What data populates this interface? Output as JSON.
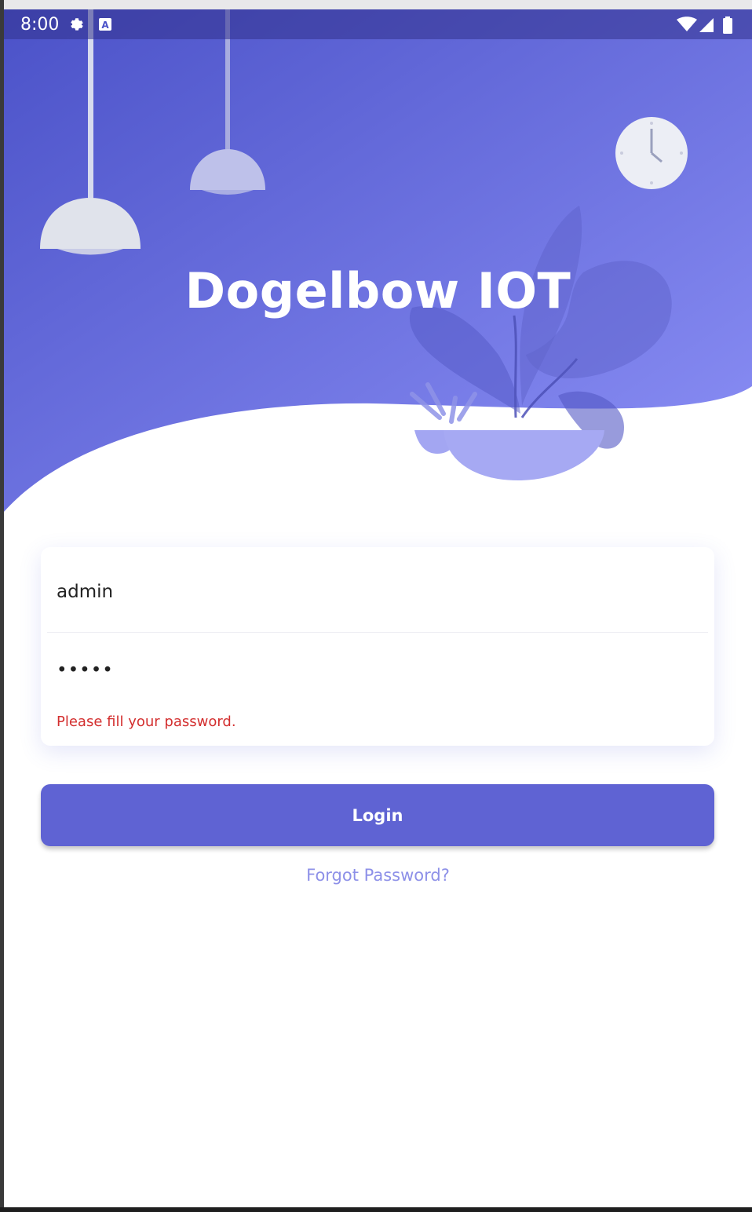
{
  "status_bar": {
    "time": "8:00",
    "icons": [
      "settings-icon",
      "keyboard-a-icon",
      "wifi-icon",
      "signal-icon",
      "battery-icon"
    ]
  },
  "header": {
    "title": "Dogelbow IOT",
    "gradient_start": "#4b52c8",
    "gradient_end": "#8a8ef5"
  },
  "login_form": {
    "username_value": "admin",
    "password_masked": "•••••",
    "password_error": "Please fill your password.",
    "login_label": "Login",
    "forgot_label": "Forgot Password?"
  },
  "colors": {
    "accent": "#5f63d3",
    "error": "#d32f2f",
    "link": "#8d90e8"
  }
}
